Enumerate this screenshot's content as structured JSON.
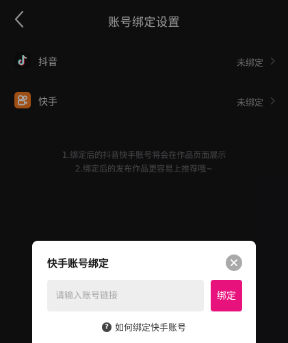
{
  "header": {
    "title": "账号绑定设置"
  },
  "accounts": [
    {
      "name": "抖音",
      "status": "未绑定"
    },
    {
      "name": "快手",
      "status": "未绑定"
    }
  ],
  "tips": [
    "1.绑定后的抖音快手账号将会在作品页面展示",
    "2.绑定后的发布作品更容易上推荐哦~"
  ],
  "dialog": {
    "title": "快手账号绑定",
    "input_value": "",
    "input_placeholder": "请输入账号链接",
    "bind_label": "绑定",
    "help_icon": "?",
    "help_label": "如何绑定快手账号"
  },
  "colors": {
    "accent": "#e8127c",
    "kuaishou": "#f57a1f",
    "background": "#161618"
  },
  "icons": {
    "back": "chevron-left-icon",
    "douyin": "douyin-logo-icon",
    "kuaishou": "kuaishou-logo-icon",
    "row_arrow": "chevron-right-icon",
    "close": "close-icon",
    "help": "question-circle-icon"
  }
}
